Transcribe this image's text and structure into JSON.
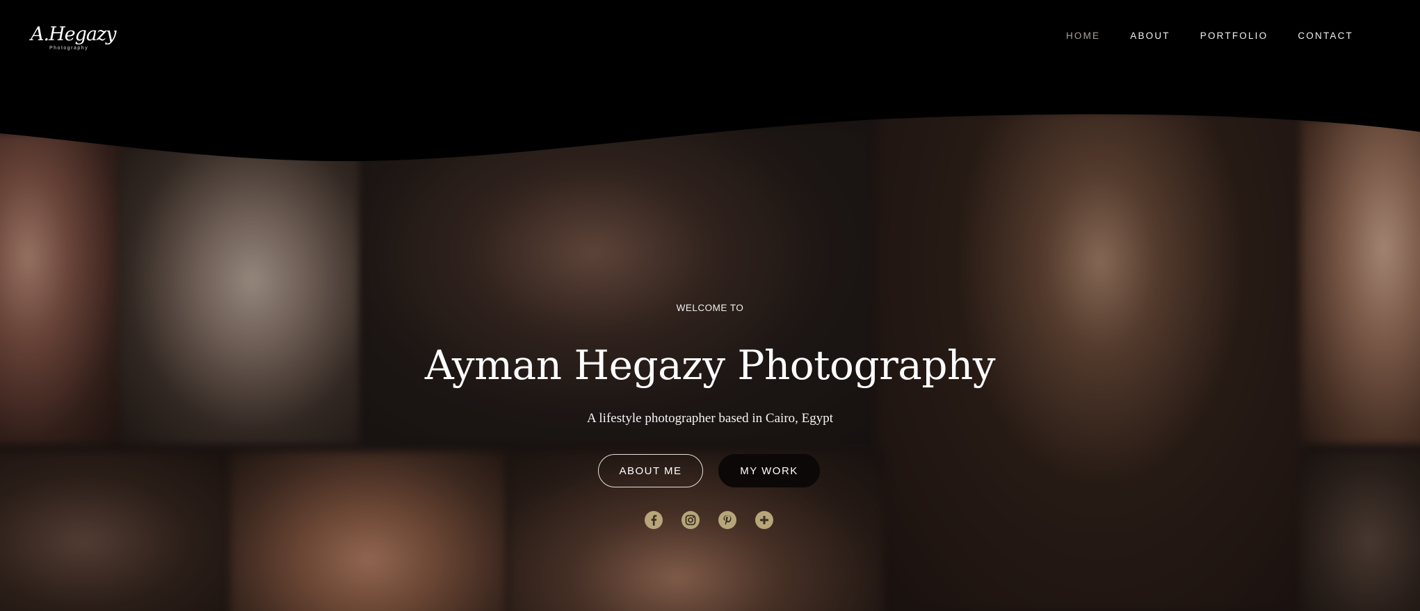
{
  "header": {
    "logo": {
      "script": "A.Hegazy",
      "sub": "Photography"
    },
    "nav": [
      {
        "label": "HOME",
        "active": true
      },
      {
        "label": "ABOUT",
        "active": false
      },
      {
        "label": "PORTFOLIO",
        "active": false
      },
      {
        "label": "CONTACT",
        "active": false
      }
    ]
  },
  "hero": {
    "welcome": "WELCOME TO",
    "title": "Ayman Hegazy Photography",
    "subtitle": "A lifestyle photographer based in Cairo, Egypt",
    "buttons": {
      "about": "ABOUT ME",
      "work": "MY WORK"
    },
    "social": [
      "facebook-icon",
      "instagram-icon",
      "pinterest-icon",
      "plus-icon"
    ]
  },
  "colors": {
    "accent": "#b7a679",
    "nav_active": "#a8a29a",
    "dark_button": "#0c0807"
  }
}
